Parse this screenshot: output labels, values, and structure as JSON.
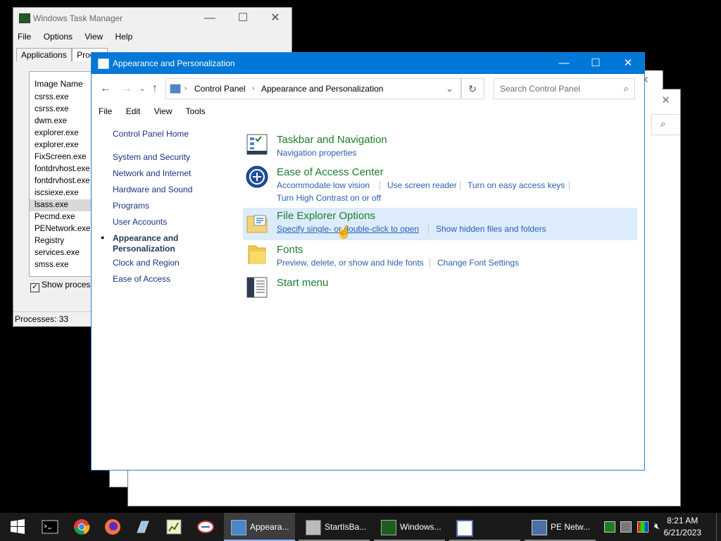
{
  "task_manager": {
    "title": "Windows Task Manager",
    "menu": [
      "File",
      "Options",
      "View",
      "Help"
    ],
    "tabs": [
      "Applications",
      "Proces"
    ],
    "column_header": "Image Name",
    "processes": [
      "csrss.exe",
      "csrss.exe",
      "dwm.exe",
      "explorer.exe",
      "explorer.exe",
      "FixScreen.exe",
      "fontdrvhost.exe",
      "fontdrvhost.exe",
      "iscsiexe.exe",
      "lsass.exe",
      "Pecmd.exe",
      "PENetwork.exe",
      "Registry",
      "services.exe",
      "smss.exe"
    ],
    "show_all_label": "Show processe",
    "status": "Processes: 33"
  },
  "window": {
    "title": "Appearance and Personalization",
    "minimize": "—",
    "maximize": "☐",
    "close": "✕"
  },
  "address": {
    "crumbs": [
      "Control Panel",
      "Appearance and Personalization"
    ],
    "search_placeholder": "Search Control Panel"
  },
  "menubar": [
    "File",
    "Edit",
    "View",
    "Tools"
  ],
  "left_nav": {
    "home": "Control Panel Home",
    "items": [
      "System and Security",
      "Network and Internet",
      "Hardware and Sound",
      "Programs",
      "User Accounts",
      "Appearance and Personalization",
      "Clock and Region",
      "Ease of Access"
    ],
    "current": "Appearance and Personalization"
  },
  "categories": [
    {
      "title": "Taskbar and Navigation",
      "links": [
        "Navigation properties"
      ],
      "icon": "taskbar-icon"
    },
    {
      "title": "Ease of Access Center",
      "links": [
        "Accommodate low vision",
        "Use screen reader",
        "Turn on easy access keys",
        "Turn High Contrast on or off"
      ],
      "icon": "ease-of-access-icon"
    },
    {
      "title": "File Explorer Options",
      "links": [
        "Specify single- or double-click to open",
        "Show hidden files and folders"
      ],
      "icon": "folder-options-icon"
    },
    {
      "title": "Fonts",
      "links": [
        "Preview, delete, or show and hide fonts",
        "Change Font Settings"
      ],
      "icon": "fonts-folder-icon"
    },
    {
      "title": "Start menu",
      "links": [],
      "icon": "start-menu-icon"
    }
  ],
  "taskbar": {
    "buttons": [
      {
        "label": "Appeara...",
        "state": "active"
      },
      {
        "label": "StartIsBa...",
        "state": "open"
      },
      {
        "label": "Windows...",
        "state": "open"
      },
      {
        "label": "",
        "state": "open"
      },
      {
        "label": "PE Netw...",
        "state": "open"
      }
    ],
    "time": "8:21 AM",
    "date": "6/21/2023"
  }
}
